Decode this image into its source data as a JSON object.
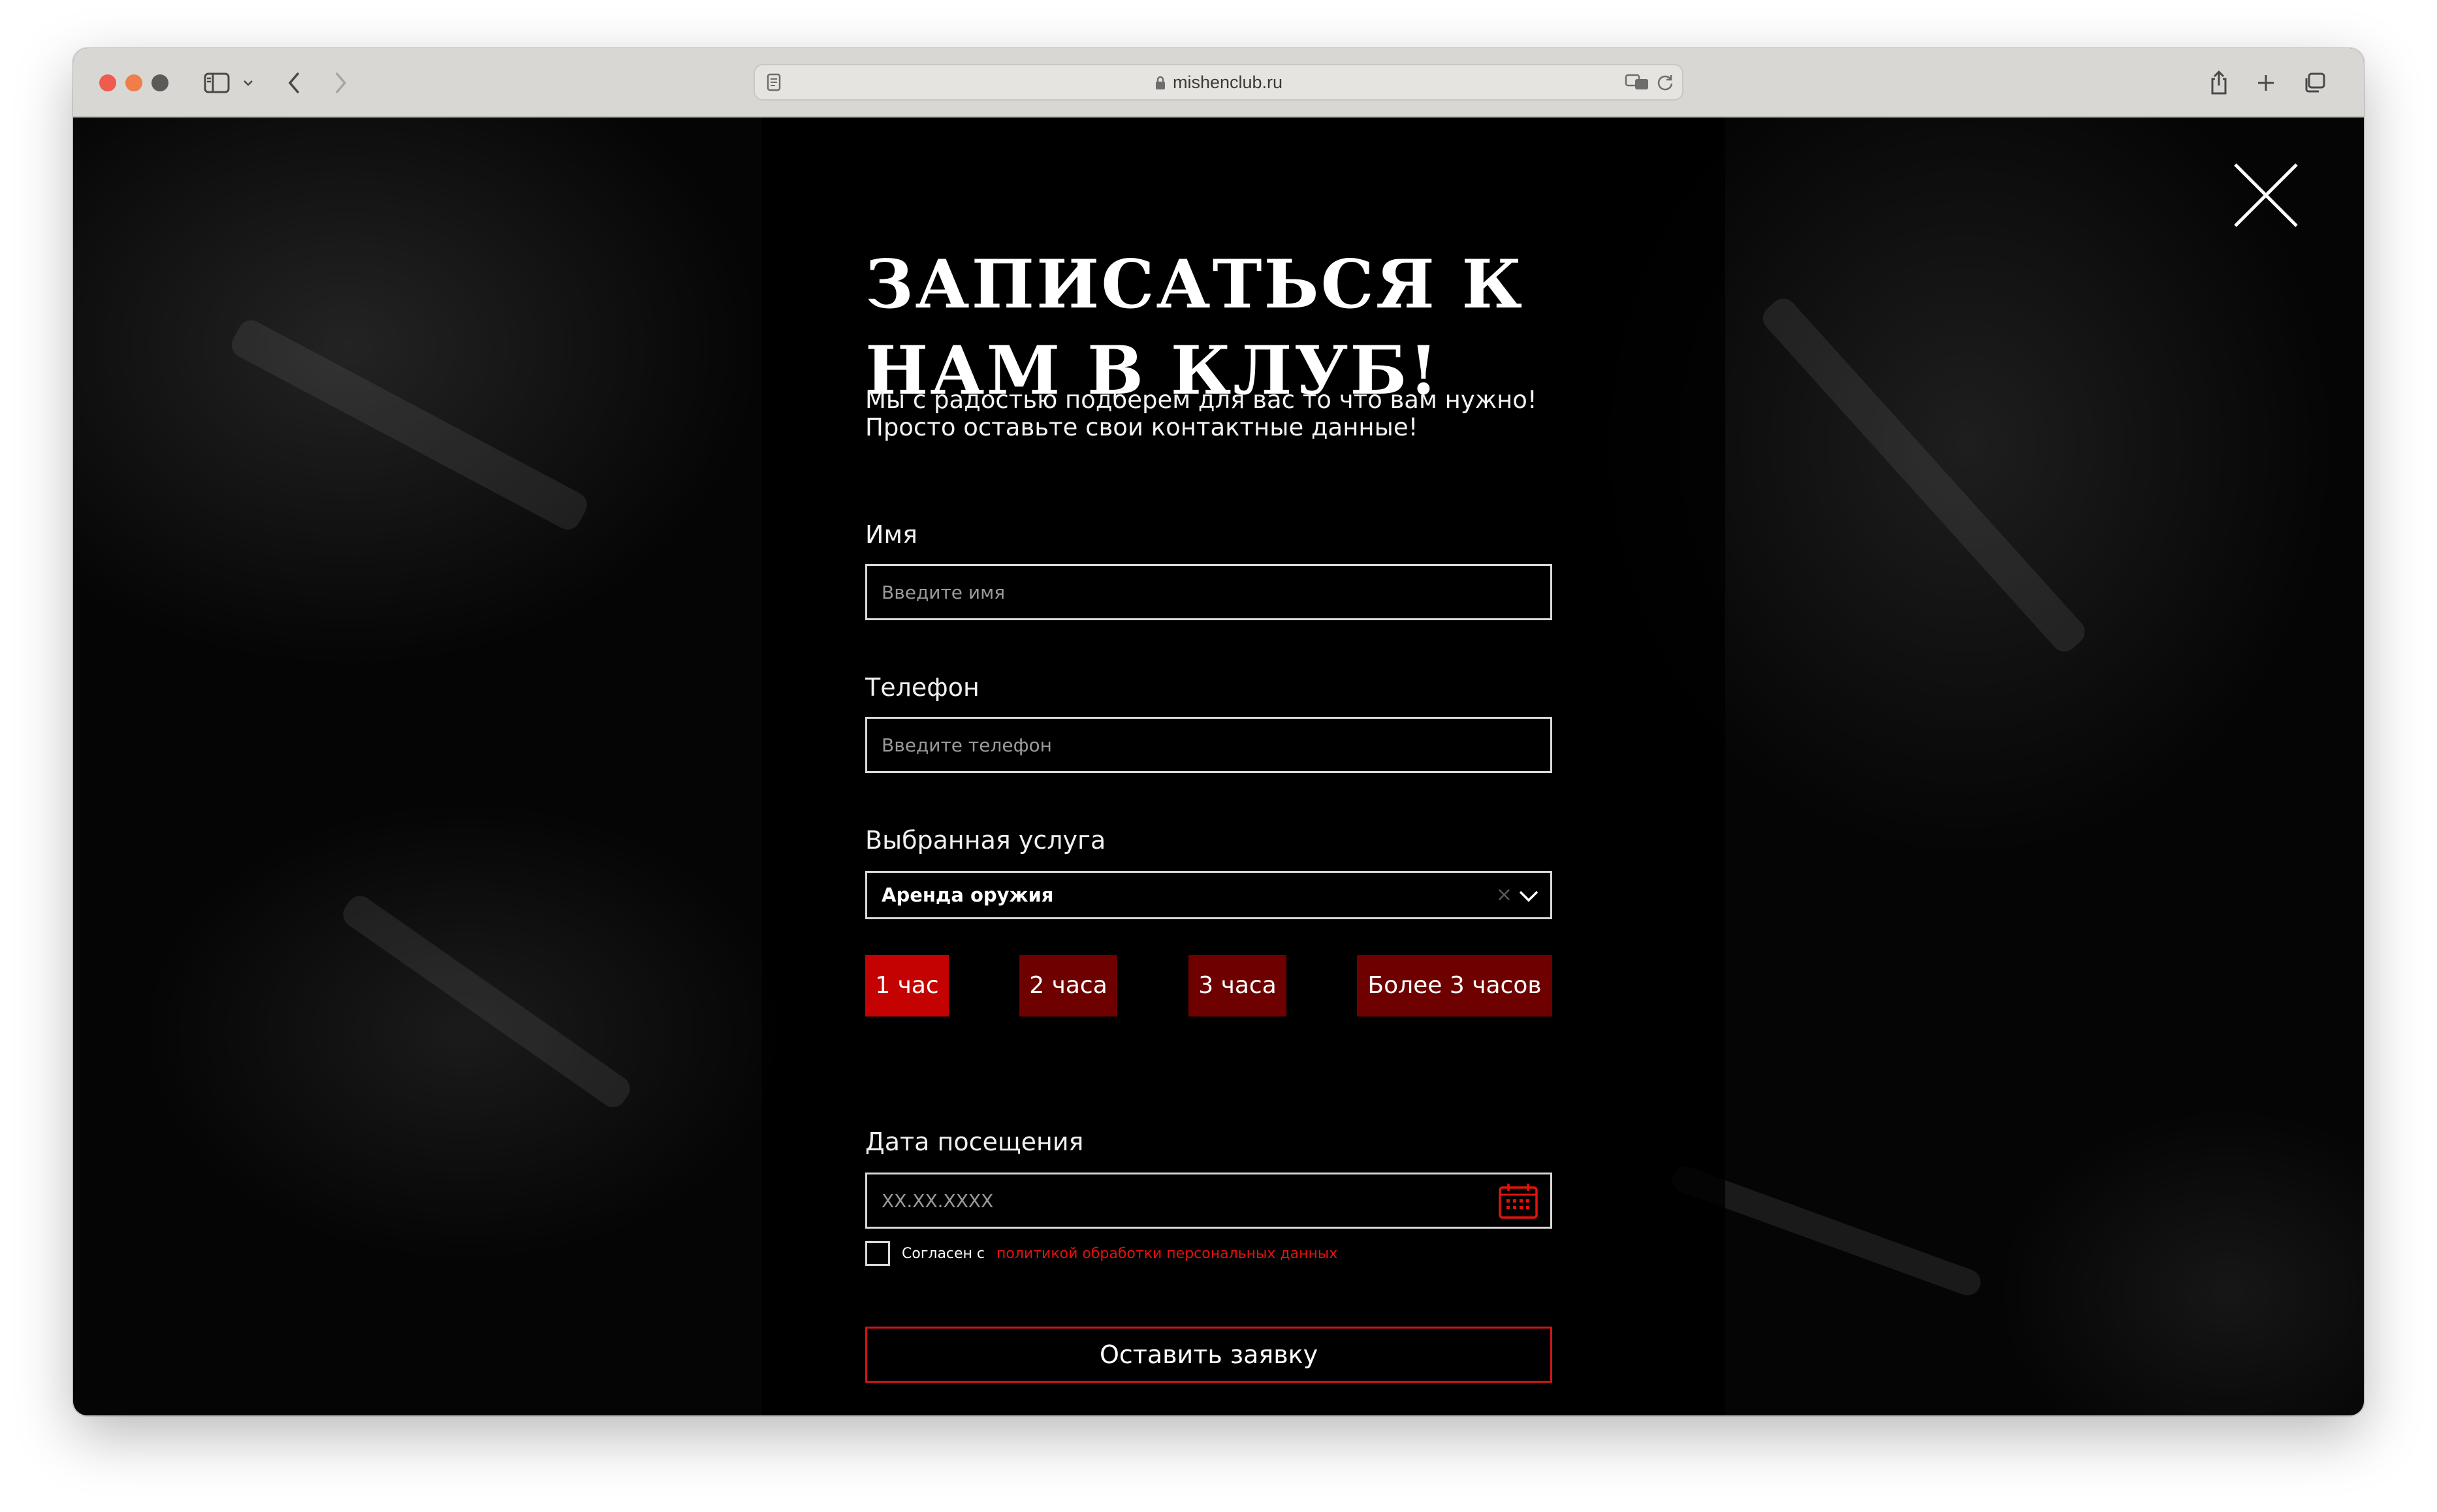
{
  "browser": {
    "url": "mishenclub.ru",
    "colors": {
      "chrome": "#d9d7d4",
      "close_dot": "#ee5b4f",
      "min_dot": "#ef7e4a",
      "max_dot": "#5c5a58"
    }
  },
  "modal": {
    "title_line1": "ЗАПИСАТЬСЯ К",
    "title_line2": "НАМ В КЛУБ!",
    "subtitle_line1": "Мы с радостью подберем для вас то что вам нужно!",
    "subtitle_line2": "Просто оставьте свои контактные данные!",
    "fields": {
      "name": {
        "label": "Имя",
        "placeholder": "Введите имя"
      },
      "phone": {
        "label": "Телефон",
        "placeholder": "Введите телефон"
      },
      "service": {
        "label": "Выбранная услуга",
        "value": "Аренда оружия",
        "clear": "×"
      },
      "date": {
        "label": "Дата посещения",
        "placeholder": "XX.XX.XXXX"
      }
    },
    "durations": [
      {
        "label": "1 час",
        "active": true
      },
      {
        "label": "2 часа",
        "active": false
      },
      {
        "label": "3 часа",
        "active": false
      },
      {
        "label": "Более 3 часов",
        "active": false
      }
    ],
    "consent": {
      "text": "Согласен с",
      "link": "политикой обработки персональных данных"
    },
    "submit_label": "Оставить заявку",
    "colors": {
      "accent": "#c40202",
      "accent_dark": "#6e0000",
      "link": "#e3120f",
      "border": "#d9d9d9"
    }
  }
}
